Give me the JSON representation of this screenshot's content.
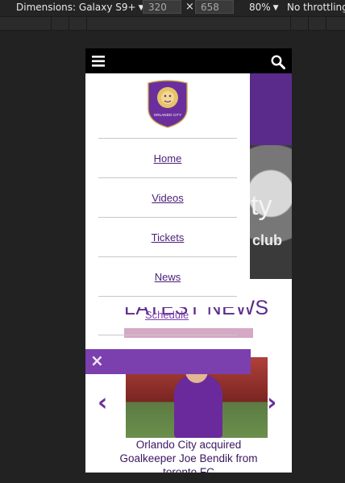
{
  "devtools": {
    "dimensions_label": "Dimensions: Galaxy S9+",
    "width_value": "320",
    "height_value": "658",
    "times_symbol": "×",
    "zoom_label": "80%",
    "throttling_label": "No throttling"
  },
  "site": {
    "menu_icon": "hamburger-icon",
    "search_icon": "search-icon",
    "crest_text": "ORLANDO CITY",
    "menu_items": [
      {
        "label": "Home"
      },
      {
        "label": "Videos"
      },
      {
        "label": "Tickets"
      },
      {
        "label": "News"
      },
      {
        "label": "Schedule"
      }
    ],
    "close_symbol": "×",
    "hero_text_1": "ty",
    "hero_text_2": "club",
    "latest_heading": "LATEST NEWS",
    "news_caption": "Orlando City acquired Goalkeeper Joe Bendik from toronto FC",
    "prev_arrow": "‹",
    "next_arrow": "›"
  },
  "colors": {
    "brand_purple": "#5a2b8a",
    "menu_link": "#4a1f78",
    "close_bar": "#7b3fae",
    "gold": "#e8c268"
  }
}
